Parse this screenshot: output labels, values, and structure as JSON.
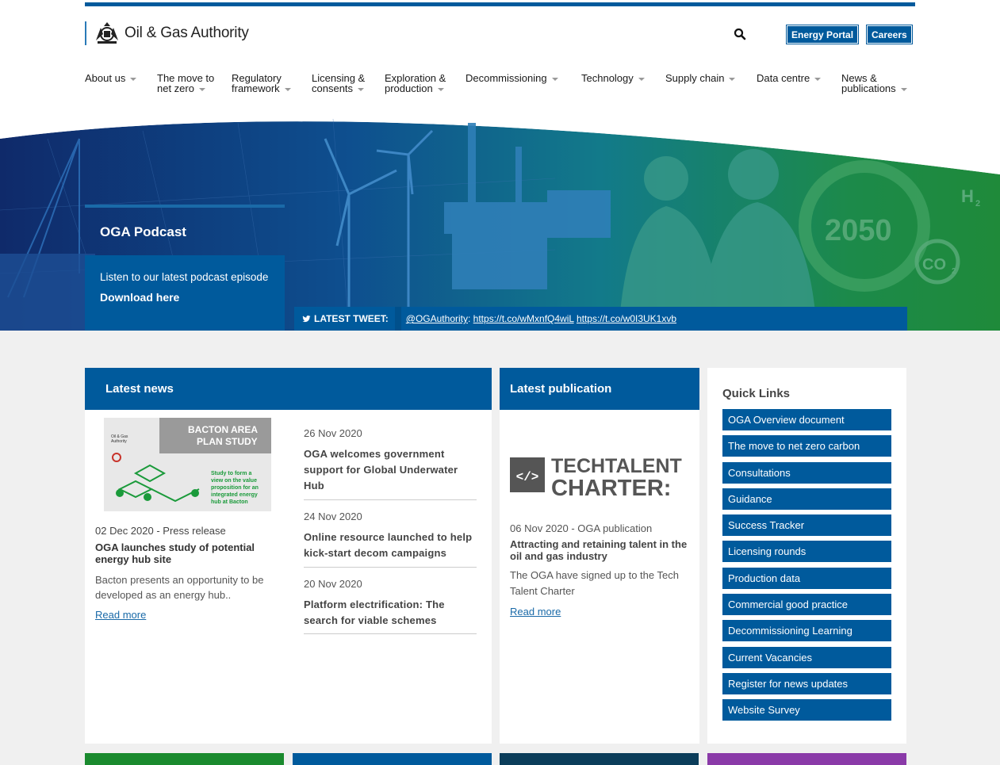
{
  "header": {
    "brand": "Oil & Gas Authority",
    "buttons": {
      "energy_portal": "Energy Portal",
      "careers": "Careers"
    }
  },
  "nav": [
    {
      "label": "About us"
    },
    {
      "label": "The move to net zero"
    },
    {
      "label": "Regulatory framework"
    },
    {
      "label": "Licensing & consents"
    },
    {
      "label": "Exploration & production"
    },
    {
      "label": "Decommissioning"
    },
    {
      "label": "Technology"
    },
    {
      "label": "Supply chain"
    },
    {
      "label": "Data centre"
    },
    {
      "label": "News & publications"
    }
  ],
  "hero": {
    "title": "OGA Podcast",
    "description": "Listen to our latest podcast episode",
    "cta": "Download here",
    "year_graphic": "2050",
    "tweet": {
      "label": "LATEST TWEET:",
      "handle": "@OGAuthority",
      "link1": "https://t.co/wMxnfQ4wiL",
      "link2": "https://t.co/w0I3UK1xvb"
    }
  },
  "latest_news": {
    "heading": "Latest news",
    "featured": {
      "image_title": "BACTON AREA PLAN STUDY",
      "image_caption": "Study to form a view on the value proposition for an integrated energy hub at Bacton",
      "meta": "02 Dec 2020 - Press release",
      "title": "OGA launches study of potential energy hub site",
      "desc": "Bacton presents an opportunity to be developed as an energy hub..",
      "read_more": "Read more"
    },
    "items": [
      {
        "date": "26 Nov 2020",
        "title": "OGA welcomes government support for Global Underwater Hub"
      },
      {
        "date": "24 Nov 2020",
        "title": "Online resource launched to help kick-start decom campaigns"
      },
      {
        "date": "20 Nov 2020",
        "title": "Platform electrification: The search for viable schemes"
      }
    ]
  },
  "latest_publication": {
    "heading": "Latest publication",
    "logo_line1": "TECHTALENT",
    "logo_line2": "CHARTER:",
    "meta": "06 Nov 2020 - OGA publication",
    "title": "Attracting and retaining talent in the oil and gas industry",
    "desc": "The OGA have signed up to the Tech Talent Charter",
    "read_more": "Read more"
  },
  "quick_links": {
    "heading": "Quick Links",
    "items": [
      "OGA Overview document",
      "The move to net zero carbon",
      "Consultations",
      "Guidance",
      "Success Tracker",
      "Licensing rounds",
      "Production data",
      "Commercial good practice",
      "Decommissioning Learning",
      "Current Vacancies",
      "Register for news updates",
      "Website Survey"
    ]
  },
  "colors": {
    "brand_blue": "#005a9c",
    "green": "#1a8a2e",
    "dark_teal": "#0b3d5a",
    "purple": "#8a3aa8"
  }
}
